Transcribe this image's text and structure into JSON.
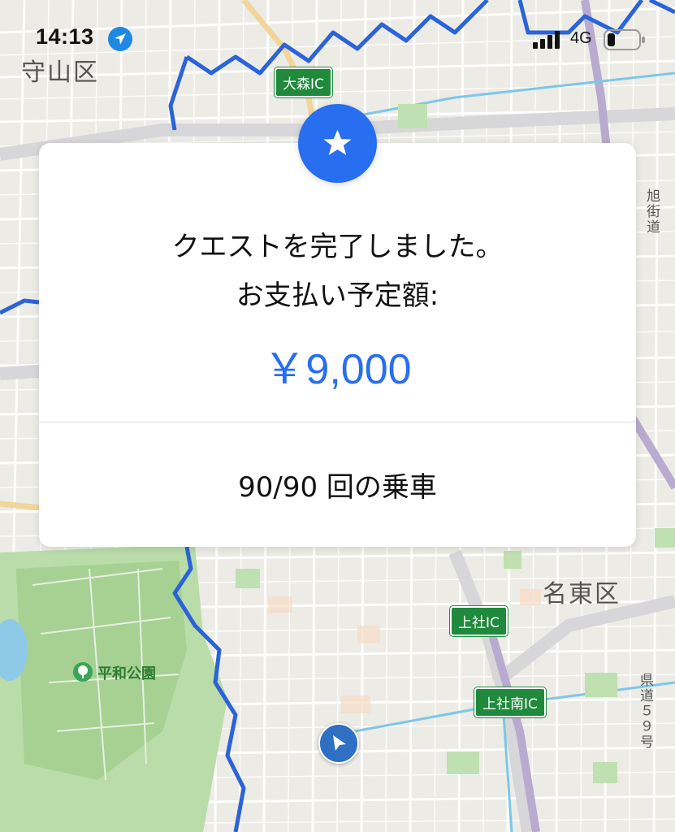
{
  "status_bar": {
    "time": "14:13",
    "network": "4G",
    "icons": [
      "location-arrow-icon",
      "signal-bars-icon",
      "battery-icon"
    ]
  },
  "map": {
    "districts": [
      "守山区",
      "名東区"
    ],
    "interchanges": [
      "大森IC",
      "上社IC",
      "上社南IC"
    ],
    "park": "平和公園",
    "side_labels": [
      "旭街道",
      "県道５９号"
    ]
  },
  "card": {
    "badge_icon": "star-icon",
    "line1": "クエストを完了しました。",
    "line2": "お支払い予定額:",
    "amount": "￥9,000",
    "rides": "90/90 回の乗車"
  },
  "colors": {
    "accent": "#276ef1",
    "boundary": "#2b63d9",
    "interchange": "#1f8a3c"
  }
}
